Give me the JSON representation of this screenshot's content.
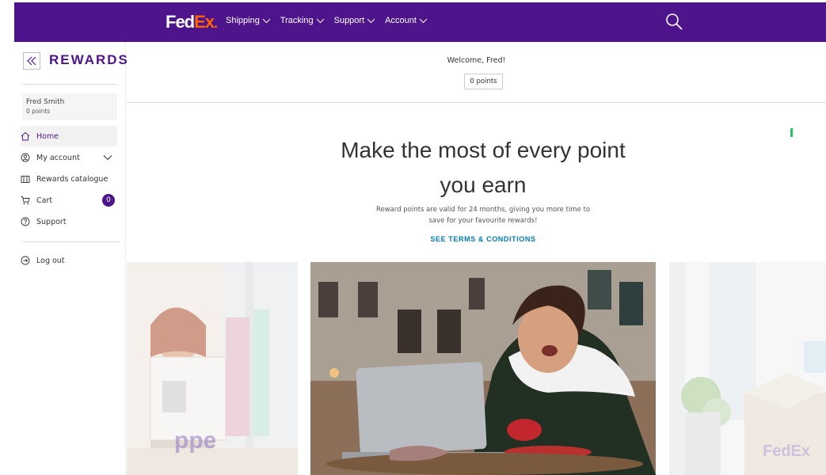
{
  "brand": {
    "logo_fed": "Fed",
    "logo_ex": "Ex",
    "logo_dot": ".",
    "purple": "#4d148c",
    "orange": "#ff6200"
  },
  "nav": {
    "items": [
      {
        "label": "Shipping"
      },
      {
        "label": "Tracking"
      },
      {
        "label": "Support"
      },
      {
        "label": "Account"
      }
    ],
    "search_icon": "search-icon"
  },
  "sidebar": {
    "title": "REWARDS",
    "collapse_icon": "double-chevron-left-icon",
    "user": {
      "name": "Fred Smith",
      "points": "0 points"
    },
    "items": [
      {
        "label": "Home",
        "icon": "home-icon"
      },
      {
        "label": "My account",
        "icon": "user-circle-icon"
      },
      {
        "label": "Rewards catalogue",
        "icon": "catalogue-icon"
      },
      {
        "label": "Cart",
        "icon": "cart-icon",
        "badge": "0"
      },
      {
        "label": "Support",
        "icon": "help-circle-icon"
      }
    ],
    "logout": {
      "label": "Log out",
      "icon": "logout-icon"
    }
  },
  "main": {
    "welcome": "Welcome, Fred!",
    "points": "0 points",
    "headline_line1": "Make the most of every point",
    "headline_line2": "you earn",
    "subtext_line1": "Reward points are valid for 24 months, giving you more time to",
    "subtext_line2": "save for your favourite rewards!",
    "terms_link": "SEE TERMS & CONDITIONS",
    "link_color": "#007ab7"
  }
}
